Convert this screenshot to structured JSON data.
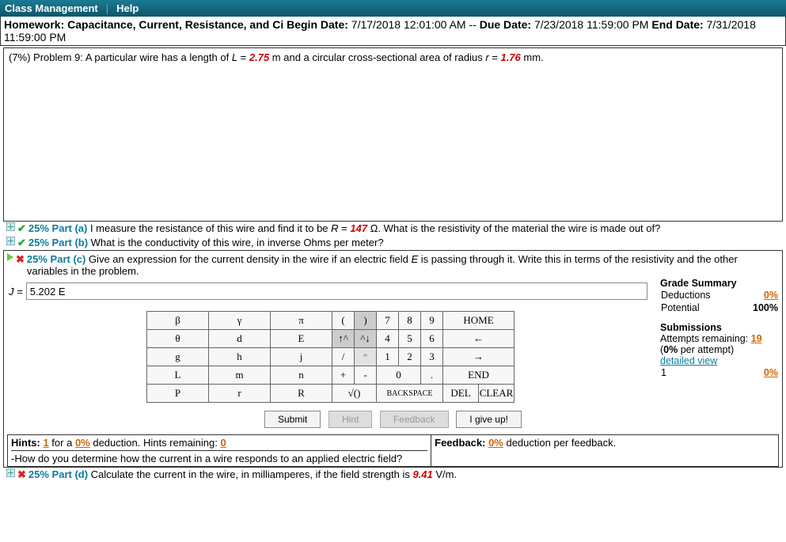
{
  "topbar": {
    "class_mgmt": "Class Management",
    "help": "Help"
  },
  "hw": {
    "label_hw": "Homework: ",
    "title": "Capacitance, Current, Resistance, and Ci ",
    "label_begin": "Begin Date: ",
    "begin": "7/17/2018 12:01:00 AM",
    "sep": " -- ",
    "label_due": "Due Date: ",
    "due": "7/23/2018 11:59:00 PM ",
    "label_end": "End Date: ",
    "end": "7/31/2018 11:59:00 PM"
  },
  "problem": {
    "pct_label": "(7%) Problem 9:",
    "pre1": " A particular wire has a length of ",
    "Lvar": "L",
    "eq1": " = ",
    "Lval": "2.75",
    "post1": " m and a circular cross-sectional area of radius ",
    "rvar": "r",
    "eq2": " = ",
    "rval": "1.76",
    "post2": " mm."
  },
  "part_a": {
    "pct": "25% Part (a)",
    "pre": " I measure the resistance of this wire and find it to be ",
    "Rvar": "R",
    "eq": " = ",
    "Rval": "147",
    "unit": " Ω",
    "post": ". What is the resistivity of the material the wire is made out of?"
  },
  "part_b": {
    "pct": "25% Part (b)",
    "text": " What is the conductivity of this wire, in inverse Ohms per meter?"
  },
  "part_c": {
    "pct": "25% Part (c)",
    "pre": " Give an expression for the current density in the wire if an electric field ",
    "Evar": "E",
    "post": " is passing through it. Write this in terms of the resistivity and the other variables in the problem."
  },
  "answer": {
    "var": "J",
    "eq": " = ",
    "value": "5.202 E"
  },
  "grade": {
    "hdr": "Grade Summary",
    "ded_label": "Deductions",
    "ded_val": "0%",
    "pot_label": "Potential",
    "pot_val": "100%",
    "sub_hdr": "Submissions",
    "att_label": "Attempts remaining: ",
    "att_val": "19",
    "perattempt_pre": "(",
    "perattempt_pct": "0%",
    "perattempt_post": " per attempt)",
    "detailed": "detailed view",
    "row1_n": "1",
    "row1_v": "0%"
  },
  "keypad": {
    "r1c1": "β",
    "r1c2": "γ",
    "r1c3": "π",
    "r2c1": "θ",
    "r2c2": "d",
    "r2c3": "E",
    "r3c1": "g",
    "r3c2": "h",
    "r3c3": "j",
    "r4c1": "L",
    "r4c2": "m",
    "r4c3": "n",
    "r5c1": "P",
    "r5c2": "r",
    "r5c3": "R",
    "op_lp": "(",
    "op_rp": ")",
    "n7": "7",
    "n8": "8",
    "n9": "9",
    "home": "HOME",
    "op_up": "↑^",
    "op_dn": "^↓",
    "n4": "4",
    "n5": "5",
    "n6": "6",
    "left": "←",
    "op_div": "/",
    "op_mul": "*",
    "n1": "1",
    "n2": "2",
    "n3": "3",
    "right": "→",
    "op_pl": "+",
    "op_mi": "-",
    "n0": "0",
    "dot": ".",
    "end": "END",
    "sqrt": "√()",
    "bksp": "BACKSPACE",
    "del": "DEL",
    "clr": "CLEAR"
  },
  "buttons": {
    "submit": "Submit",
    "hint": "Hint",
    "feedback": "Feedback",
    "giveup": "I give up!"
  },
  "hints": {
    "label": "Hints: ",
    "n": "1",
    "mid": " for a ",
    "pct": "0%",
    "ded": " deduction. Hints remaining: ",
    "rem": "0",
    "body": "-How do you determine how the current in a wire responds to an applied electric field?"
  },
  "feedback": {
    "label": "Feedback: ",
    "pct": "0%",
    "text": " deduction per feedback."
  },
  "part_d": {
    "pct": "25% Part (d)",
    "pre": " Calculate the current in the wire, in milliamperes, if the field strength is ",
    "val": "9.41",
    "post": " V/m."
  }
}
